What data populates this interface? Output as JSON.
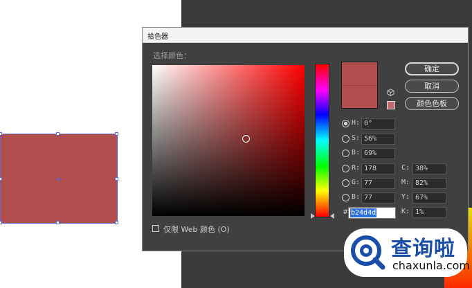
{
  "dialog": {
    "title": "拾色器",
    "prompt": "选择颜色：",
    "buttons": {
      "ok": "确定",
      "cancel": "取消",
      "swatches": "颜色色板"
    },
    "fields": {
      "H": {
        "label": "H:",
        "value": "0°",
        "selected": true
      },
      "S": {
        "label": "S:",
        "value": "56%"
      },
      "Bv": {
        "label": "B:",
        "value": "69%"
      },
      "R": {
        "label": "R:",
        "value": "178"
      },
      "G": {
        "label": "G:",
        "value": "77"
      },
      "Bb": {
        "label": "B:",
        "value": "77"
      },
      "C": {
        "label": "C:",
        "value": "38%"
      },
      "M": {
        "label": "M:",
        "value": "82%"
      },
      "Y": {
        "label": "Y:",
        "value": "67%"
      },
      "K": {
        "label": "K:",
        "value": "1%"
      }
    },
    "hex": {
      "label": "#",
      "value": "b24d4d"
    },
    "web_only_label": "仅限 Web 颜色 (O)",
    "web_only_checked": false,
    "current_color": "#b24d4d"
  },
  "canvas": {
    "shape_fill": "#b24d4d"
  },
  "icons": {
    "cube": "cube-icon",
    "warning": "websafe-warning-icon"
  },
  "watermark": {
    "brand": "查询啦",
    "url": "chaxunla.com"
  }
}
